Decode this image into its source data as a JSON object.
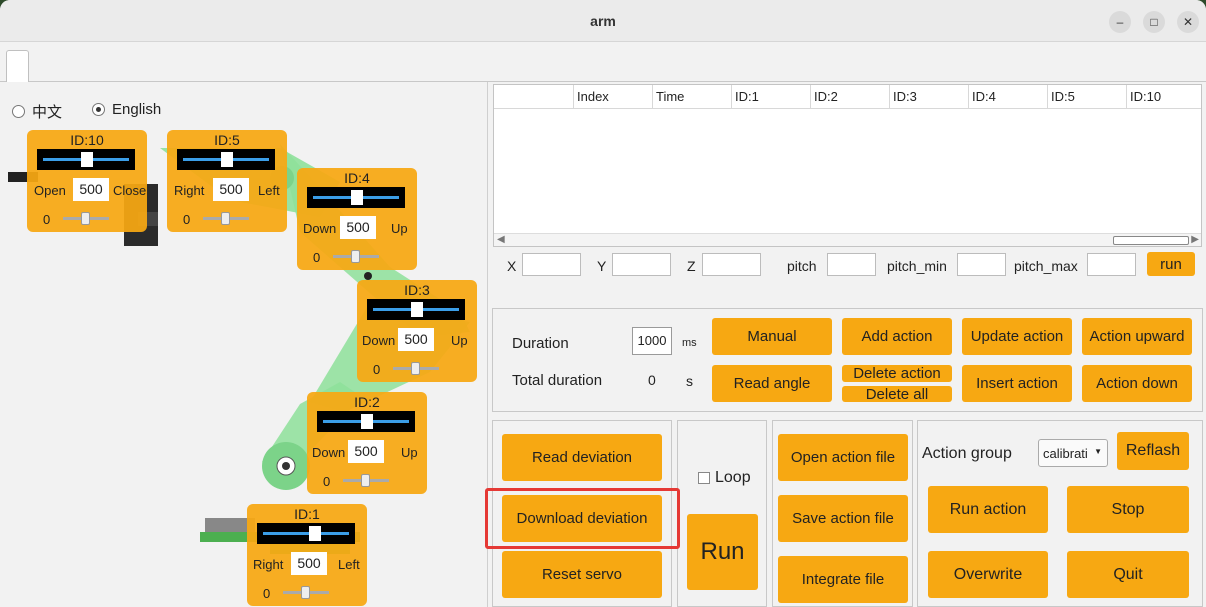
{
  "window": {
    "title": "arm"
  },
  "language": {
    "options": [
      "中文",
      "English"
    ],
    "selected": "English"
  },
  "servos": [
    {
      "id": "ID:10",
      "left_label": "Open",
      "right_label": "Close",
      "value": "500",
      "offset": "0"
    },
    {
      "id": "ID:5",
      "left_label": "Right",
      "right_label": "Left",
      "value": "500",
      "offset": "0"
    },
    {
      "id": "ID:4",
      "left_label": "Down",
      "right_label": "Up",
      "value": "500",
      "offset": "0"
    },
    {
      "id": "ID:3",
      "left_label": "Down",
      "right_label": "Up",
      "value": "500",
      "offset": "0"
    },
    {
      "id": "ID:2",
      "left_label": "Down",
      "right_label": "Up",
      "value": "500",
      "offset": "0"
    },
    {
      "id": "ID:1",
      "left_label": "Right",
      "right_label": "Left",
      "value": "500",
      "offset": "0"
    }
  ],
  "table": {
    "headers": [
      "",
      "Index",
      "Time",
      "ID:1",
      "ID:2",
      "ID:3",
      "ID:4",
      "ID:5",
      "ID:10"
    ]
  },
  "coords": {
    "x": "X",
    "y": "Y",
    "z": "Z",
    "pitch": "pitch",
    "pitch_min": "pitch_min",
    "pitch_max": "pitch_max",
    "run": "run"
  },
  "action": {
    "duration_label": "Duration",
    "duration_value": "1000",
    "duration_unit": "ms",
    "total_label": "Total duration",
    "total_value": "0",
    "total_unit": "s",
    "manual": "Manual",
    "add": "Add action",
    "update": "Update action",
    "upward": "Action upward",
    "read_angle": "Read angle",
    "delete": "Delete action",
    "delete_all": "Delete all",
    "insert": "Insert action",
    "down": "Action down"
  },
  "deviation": {
    "read": "Read deviation",
    "download": "Download deviation",
    "reset": "Reset servo"
  },
  "run_panel": {
    "loop": "Loop",
    "run": "Run"
  },
  "files": {
    "open": "Open action file",
    "save": "Save action file",
    "integrate": "Integrate file"
  },
  "group": {
    "label": "Action group",
    "selected": "calibrati",
    "reflash": "Reflash",
    "run_action": "Run action",
    "stop": "Stop",
    "overwrite": "Overwrite",
    "quit": "Quit"
  },
  "colors": {
    "button": "#f7a812",
    "highlight": "#e53935",
    "arm": "#7dd98a"
  }
}
